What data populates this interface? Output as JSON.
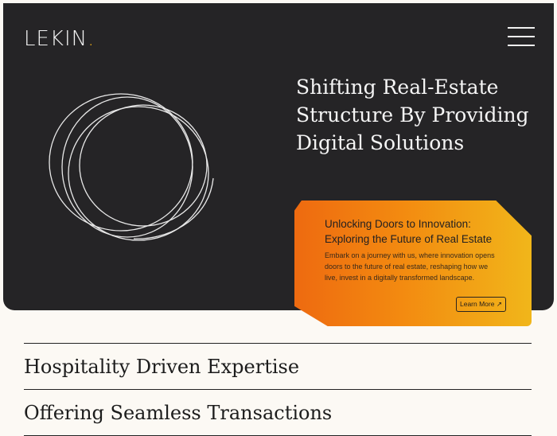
{
  "header": {
    "logo_text": "LEKIN",
    "logo_dot": ".",
    "menu_icon": "hamburger-menu-icon"
  },
  "hero": {
    "title_lines": [
      "Shifting Real-Estate",
      "Structure By Providing",
      "Digital Solutions"
    ],
    "graphic_icon": "circle-swirl-graphic"
  },
  "card": {
    "title_lines": [
      "Unlocking Doors to Innovation:",
      "Exploring the Future of Real Estate"
    ],
    "text_lines": [
      "Embark on a journey with us, where innovation opens",
      "doors to the future of real estate, reshaping how we",
      "live, invest in a digitally transformed landscape."
    ],
    "button_label": "Learn More ↗"
  },
  "services": {
    "items": [
      "Hospitality Driven Expertise",
      "Offering Seamless Transactions"
    ]
  },
  "colors": {
    "hero_bg": "#252426",
    "page_bg": "#fcf9f4",
    "accent": "#f1b018",
    "card_gradient_start": "#ee6a10",
    "card_gradient_end": "#f1b61a"
  }
}
